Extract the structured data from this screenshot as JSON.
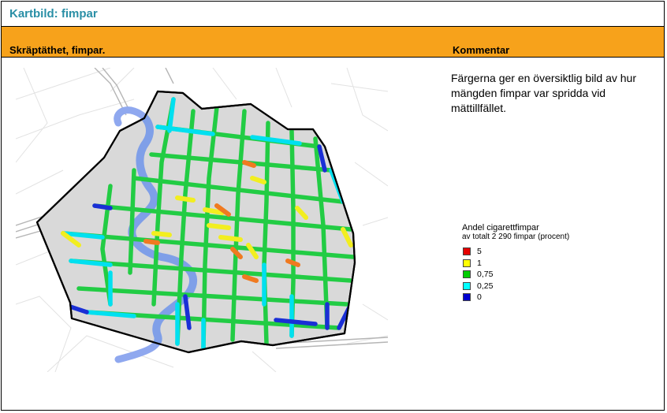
{
  "header": {
    "title": "Kartbild: fimpar"
  },
  "columns": {
    "left": "Skräptäthet, fimpar.",
    "right": "Kommentar"
  },
  "comment": "Färgerna ger en översiktlig bild av hur mängden fimpar var spridda vid mättillfället.",
  "legend": {
    "title": "Andel cigarettfimpar",
    "subtitle": "av totalt 2 290 fimpar (procent)",
    "items": [
      {
        "label": "5",
        "color": "#e60000"
      },
      {
        "label": "1",
        "color": "#ffff00"
      },
      {
        "label": "0,75",
        "color": "#00cc00"
      },
      {
        "label": "0,25",
        "color": "#00ffff"
      },
      {
        "label": "0",
        "color": "#0000d0"
      }
    ]
  }
}
